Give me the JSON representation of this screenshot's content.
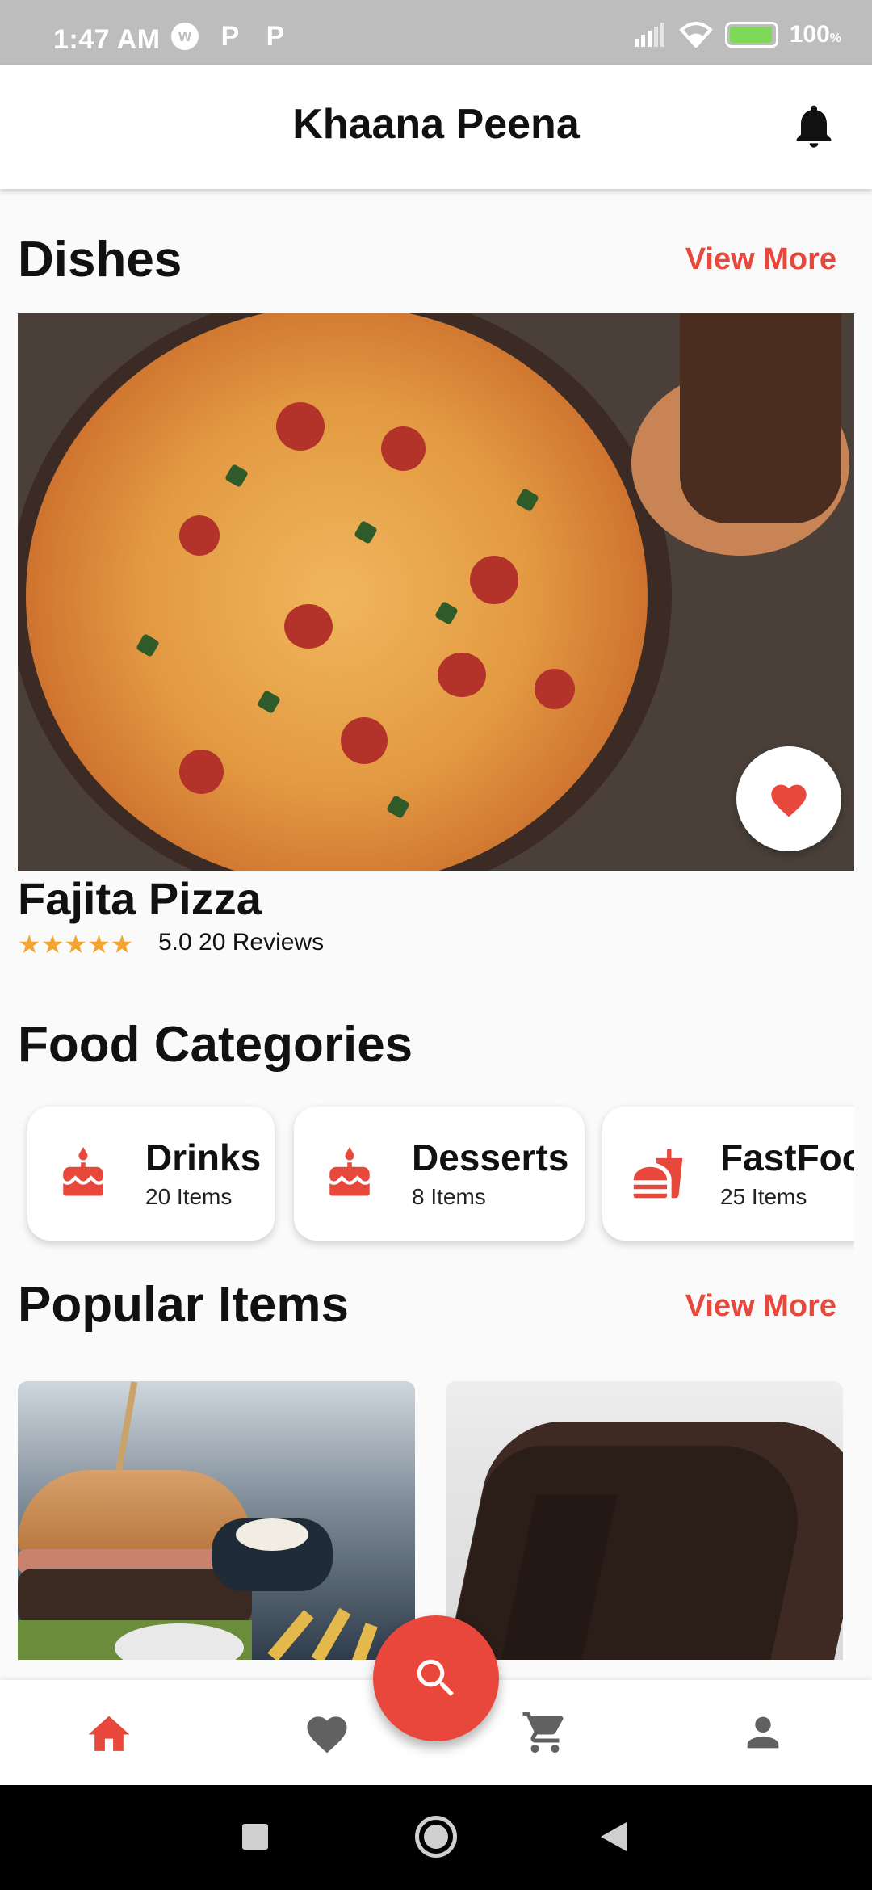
{
  "status_bar": {
    "time": "1:47 AM",
    "battery": "100",
    "battery_unit": "%"
  },
  "app_bar": {
    "title": "Khaana Peena"
  },
  "dishes": {
    "heading": "Dishes",
    "view_more": "View More",
    "featured": {
      "name": "Fajita Pizza",
      "stars": "★★★★★",
      "rating": "5.0 20 Reviews"
    }
  },
  "categories": {
    "heading": "Food Categories",
    "items": [
      {
        "name": "Drinks",
        "count": "20 Items",
        "icon": "cake-icon"
      },
      {
        "name": "Desserts",
        "count": "8 Items",
        "icon": "cake-icon"
      },
      {
        "name": "FastFoo",
        "count": "25 Items",
        "icon": "fastfood-icon"
      }
    ]
  },
  "popular": {
    "heading": "Popular Items",
    "view_more": "View More"
  },
  "bottom_nav": {
    "items": [
      "home-icon",
      "heart-icon",
      "cart-icon",
      "person-icon"
    ],
    "fab": "search-icon"
  },
  "colors": {
    "accent": "#e8473c",
    "star": "#f4a531"
  }
}
